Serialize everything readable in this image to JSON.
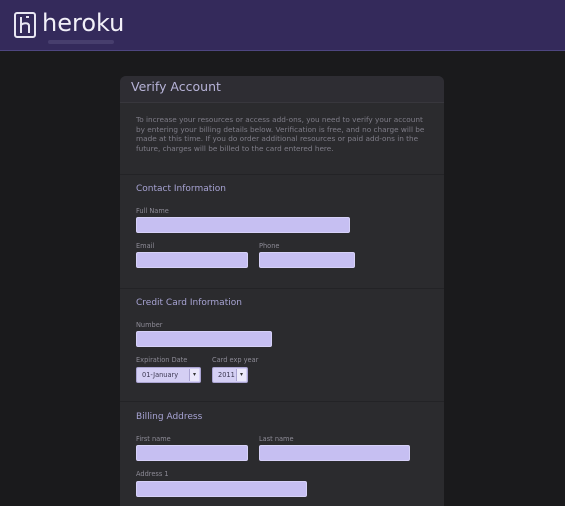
{
  "header": {
    "brand": "heroku",
    "logo_icon": "heroku-logo-icon"
  },
  "form": {
    "title": "Verify Account",
    "intro": "To increase your resources or access add-ons, you need to verify your account by entering your billing details below. Verification is free, and no charge will be made at this time. If you do order additional resources or paid add-ons in the future, charges will be billed to the card entered here.",
    "contact": {
      "title": "Contact Information",
      "full_name_label": "Full Name",
      "email_label": "Email",
      "phone_label": "Phone",
      "full_name_value": "",
      "email_value": "",
      "phone_value": ""
    },
    "card": {
      "title": "Credit Card Information",
      "number_label": "Number",
      "number_value": "",
      "exp_date_label": "Expiration Date",
      "exp_month_selected": "01-January",
      "exp_year_label": "Card exp year",
      "exp_year_selected": "2011"
    },
    "billing": {
      "title": "Billing Address",
      "first_name_label": "First name",
      "last_name_label": "Last name",
      "address1_label": "Address 1",
      "first_name_value": "",
      "last_name_value": "",
      "address1_value": ""
    }
  },
  "colors": {
    "header_bg": "#342a5b",
    "page_bg": "#1a1a1c",
    "panel_bg": "#2b2b2e",
    "accent_text": "#a7a3d3",
    "input_bg": "#c6bff2"
  }
}
